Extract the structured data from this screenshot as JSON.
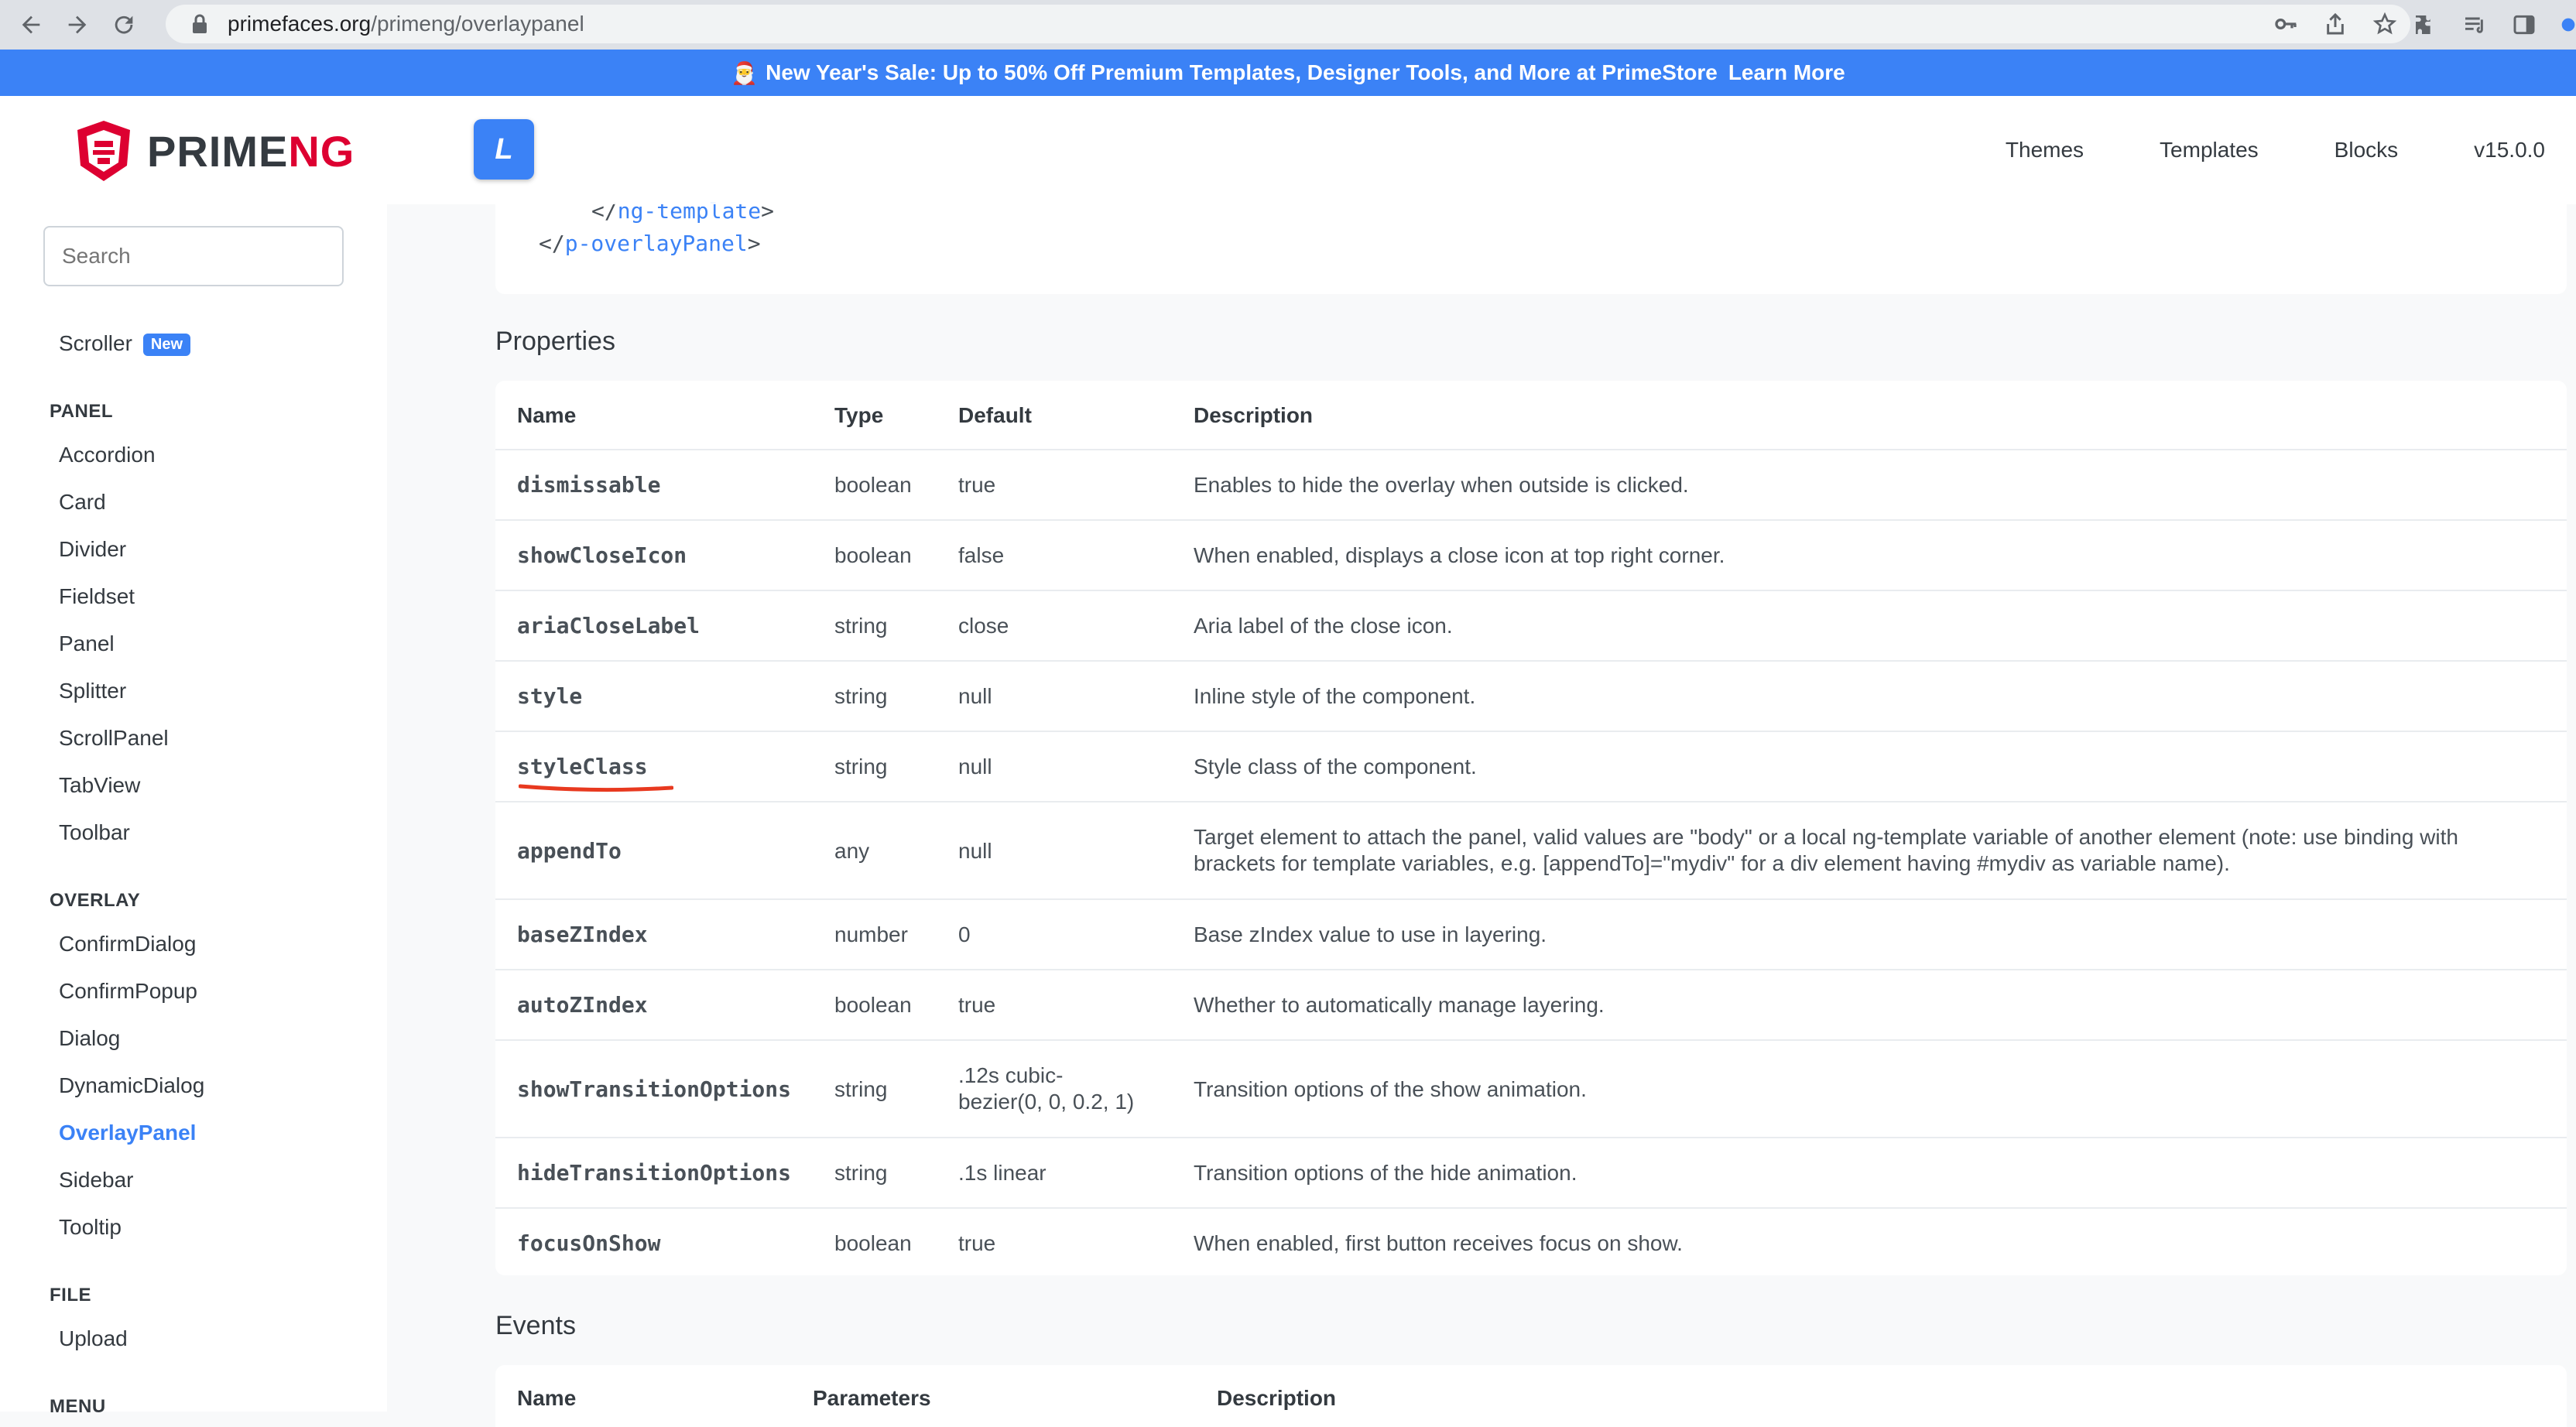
{
  "browser": {
    "url_host": "primefaces.org",
    "url_path": "/primeng/overlaypanel"
  },
  "banner": {
    "gift": "🎅",
    "text": "New Year's Sale: Up to 50% Off Premium Templates, Designer Tools, and More at PrimeStore",
    "link": "Learn More"
  },
  "brand": {
    "part1": "PRIME",
    "part2": "NG"
  },
  "topbar": {
    "logo_letter": "L",
    "menu": [
      "Themes",
      "Templates",
      "Blocks",
      "v15.0.0"
    ]
  },
  "sidebar": {
    "search_placeholder": "Search",
    "scroller": "Scroller",
    "new_badge": "New",
    "sections": [
      {
        "title": "PANEL",
        "items": [
          "Accordion",
          "Card",
          "Divider",
          "Fieldset",
          "Panel",
          "Splitter",
          "ScrollPanel",
          "TabView",
          "Toolbar"
        ]
      },
      {
        "title": "OVERLAY",
        "items": [
          "ConfirmDialog",
          "ConfirmPopup",
          "Dialog",
          "DynamicDialog",
          "OverlayPanel",
          "Sidebar",
          "Tooltip"
        ]
      },
      {
        "title": "FILE",
        "items": [
          "Upload"
        ]
      },
      {
        "title": "MENU",
        "items": []
      }
    ],
    "active_item": "OverlayPanel"
  },
  "code": {
    "line1_open": "</",
    "line1_tag": "ng-template",
    "line1_close": ">",
    "line2_open": "</",
    "line2_tag": "p-overlayPanel",
    "line2_close": ">"
  },
  "properties": {
    "title": "Properties",
    "headers": [
      "Name",
      "Type",
      "Default",
      "Description"
    ],
    "rows": [
      {
        "name": "dismissable",
        "type": "boolean",
        "default": "true",
        "description": "Enables to hide the overlay when outside is clicked."
      },
      {
        "name": "showCloseIcon",
        "type": "boolean",
        "default": "false",
        "description": "When enabled, displays a close icon at top right corner."
      },
      {
        "name": "ariaCloseLabel",
        "type": "string",
        "default": "close",
        "description": "Aria label of the close icon."
      },
      {
        "name": "style",
        "type": "string",
        "default": "null",
        "description": "Inline style of the component."
      },
      {
        "name": "styleClass",
        "type": "string",
        "default": "null",
        "description": "Style class of the component."
      },
      {
        "name": "appendTo",
        "type": "any",
        "default": "null",
        "description": "Target element to attach the panel, valid values are \"body\" or a local ng-template variable of another element (note: use binding with",
        "description2": "brackets for template variables, e.g. [appendTo]=\"mydiv\" for a div element having #mydiv as variable name)."
      },
      {
        "name": "baseZIndex",
        "type": "number",
        "default": "0",
        "description": "Base zIndex value to use in layering."
      },
      {
        "name": "autoZIndex",
        "type": "boolean",
        "default": "true",
        "description": "Whether to automatically manage layering."
      },
      {
        "name": "showTransitionOptions",
        "type": "string",
        "default": ".12s cubic-",
        "default2": "bezier(0, 0, 0.2, 1)",
        "description": "Transition options of the show animation."
      },
      {
        "name": "hideTransitionOptions",
        "type": "string",
        "default": ".1s linear",
        "description": "Transition options of the hide animation."
      },
      {
        "name": "focusOnShow",
        "type": "boolean",
        "default": "true",
        "description": "When enabled, first button receives focus on show."
      }
    ]
  },
  "events": {
    "title": "Events",
    "headers": [
      "Name",
      "Parameters",
      "Description"
    ]
  },
  "colors": {
    "accent": "#3b82f6",
    "annotation": "#e8391f",
    "brand_red": "#dd0031"
  }
}
